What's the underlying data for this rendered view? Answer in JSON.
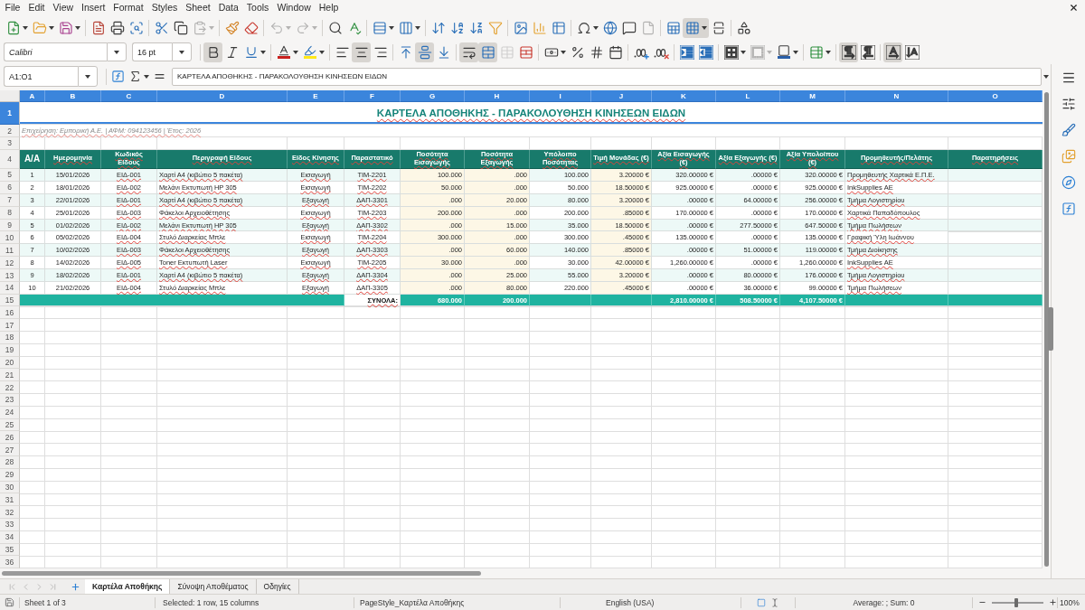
{
  "menu_bar": [
    "File",
    "Edit",
    "View",
    "Insert",
    "Format",
    "Styles",
    "Sheet",
    "Data",
    "Tools",
    "Window",
    "Help"
  ],
  "standard_toolbar": [
    {
      "on": false,
      "disabled": false
    },
    {
      "on": false,
      "disabled": false
    },
    {
      "on": false,
      "disabled": false
    },
    {
      "on": false,
      "disabled": false
    },
    {
      "on": false,
      "disabled": false
    },
    {
      "on": false,
      "disabled": false
    },
    {
      "on": false,
      "disabled": false
    },
    {
      "on": false,
      "disabled": false
    },
    {
      "on": false,
      "disabled": true
    },
    {
      "on": false,
      "disabled": false
    },
    {
      "on": false,
      "disabled": false
    },
    {
      "on": false,
      "disabled": true
    },
    {
      "on": false,
      "disabled": true
    },
    {
      "on": false,
      "disabled": false
    },
    {
      "on": false,
      "disabled": false
    },
    {
      "on": false,
      "disabled": false
    },
    {
      "on": false,
      "disabled": false
    },
    {
      "on": false,
      "disabled": false
    },
    {
      "on": false,
      "disabled": false
    },
    {
      "on": false,
      "disabled": false
    },
    {
      "on": false,
      "disabled": false
    },
    {
      "on": false,
      "disabled": false
    },
    {
      "on": false,
      "disabled": false
    },
    {
      "on": false,
      "disabled": false
    },
    {
      "on": false,
      "disabled": false
    },
    {
      "on": false,
      "disabled": false
    },
    {
      "on": false,
      "disabled": false
    },
    {
      "on": false,
      "disabled": true
    },
    {
      "on": false,
      "disabled": false
    },
    {
      "on": true,
      "disabled": false
    },
    {
      "on": false,
      "disabled": false
    },
    {
      "on": false,
      "disabled": false
    }
  ],
  "formatting_toolbar": {
    "font_name": "Calibri",
    "font_size": "16 pt",
    "buttons": [
      {
        "on": true,
        "disabled": false
      },
      {
        "on": false,
        "disabled": false
      },
      {
        "on": false,
        "disabled": false
      },
      {
        "on": false,
        "disabled": false
      },
      {
        "on": false,
        "disabled": false
      },
      {
        "on": false,
        "disabled": false
      },
      {
        "on": true,
        "disabled": false
      },
      {
        "on": false,
        "disabled": false
      },
      {
        "on": false,
        "disabled": false
      },
      {
        "on": true,
        "disabled": false
      },
      {
        "on": false,
        "disabled": false
      },
      {
        "on": true,
        "disabled": false
      },
      {
        "on": true,
        "disabled": false
      },
      {
        "on": false,
        "disabled": true
      },
      {
        "on": false,
        "disabled": false
      },
      {
        "on": false,
        "disabled": false
      },
      {
        "on": false,
        "disabled": false
      },
      {
        "on": false,
        "disabled": false
      },
      {
        "on": false,
        "disabled": false
      },
      {
        "on": false,
        "disabled": false
      },
      {
        "on": false,
        "disabled": false
      },
      {
        "on": false,
        "disabled": false
      },
      {
        "on": false,
        "disabled": false
      },
      {
        "on": false,
        "disabled": false
      },
      {
        "on": false,
        "disabled": true
      },
      {
        "on": false,
        "disabled": false
      },
      {
        "on": false,
        "disabled": false
      },
      {
        "on": true,
        "disabled": false
      },
      {
        "on": false,
        "disabled": false
      },
      {
        "on": true,
        "disabled": false
      },
      {
        "on": false,
        "disabled": false
      }
    ]
  },
  "formula_bar": {
    "name_box": "A1:O1",
    "formula": "ΚΑΡΤΕΛΑ ΑΠΟΘΗΚΗΣ - ΠΑΡΑΚΟΛΟΥΘΗΣΗ ΚΙΝΗΣΕΩΝ ΕΙΔΩΝ"
  },
  "sheet": {
    "column_headers": [
      {
        "label": "A",
        "selected": true
      },
      {
        "label": "B",
        "selected": true
      },
      {
        "label": "C",
        "selected": true
      },
      {
        "label": "D",
        "selected": true
      },
      {
        "label": "E",
        "selected": true
      },
      {
        "label": "F",
        "selected": true
      },
      {
        "label": "G",
        "selected": true
      },
      {
        "label": "H",
        "selected": true
      },
      {
        "label": "I",
        "selected": true
      },
      {
        "label": "J",
        "selected": true
      },
      {
        "label": "K",
        "selected": true
      },
      {
        "label": "L",
        "selected": true
      },
      {
        "label": "M",
        "selected": true
      },
      {
        "label": "N",
        "selected": true
      },
      {
        "label": "O",
        "selected": true
      }
    ],
    "row_headers": [
      {
        "label": "1",
        "selected": true
      },
      {
        "label": "2",
        "selected": false
      },
      {
        "label": "3",
        "selected": false
      },
      {
        "label": "4",
        "selected": false
      },
      {
        "label": "5",
        "selected": false
      },
      {
        "label": "6",
        "selected": false
      },
      {
        "label": "7",
        "selected": false
      },
      {
        "label": "8",
        "selected": false
      },
      {
        "label": "9",
        "selected": false
      },
      {
        "label": "10",
        "selected": false
      },
      {
        "label": "11",
        "selected": false
      },
      {
        "label": "12",
        "selected": false
      },
      {
        "label": "13",
        "selected": false
      },
      {
        "label": "14",
        "selected": false
      },
      {
        "label": "15",
        "selected": false
      },
      {
        "label": "16",
        "selected": false
      },
      {
        "label": "17",
        "selected": false
      },
      {
        "label": "18",
        "selected": false
      },
      {
        "label": "19",
        "selected": false
      },
      {
        "label": "20",
        "selected": false
      },
      {
        "label": "21",
        "selected": false
      },
      {
        "label": "22",
        "selected": false
      },
      {
        "label": "23",
        "selected": false
      },
      {
        "label": "24",
        "selected": false
      },
      {
        "label": "25",
        "selected": false
      },
      {
        "label": "26",
        "selected": false
      },
      {
        "label": "27",
        "selected": false
      },
      {
        "label": "28",
        "selected": false
      },
      {
        "label": "29",
        "selected": false
      },
      {
        "label": "30",
        "selected": false
      },
      {
        "label": "31",
        "selected": false
      },
      {
        "label": "32",
        "selected": false
      },
      {
        "label": "33",
        "selected": false
      },
      {
        "label": "34",
        "selected": false
      },
      {
        "label": "35",
        "selected": false
      },
      {
        "label": "36",
        "selected": false
      }
    ],
    "title": {
      "text": "ΚΑΡΤΕΛΑ ΑΠΟΘΗΚΗΣ - ΠΑΡΑΚΟΛΟΥΘΗΣΗ ΚΙΝΗΣΕΩΝ ΕΙΔΩΝ",
      "selected": true
    },
    "info_line": "Επιχείρηση: Εμπορική Α.Ε. | ΑΦΜ: 094123456 | Έτος: 2026",
    "table_headers": [
      "Α/Α",
      "Ημερομηνία",
      "Κωδικός Είδους",
      "Περιγραφή Είδους",
      "Είδος Κίνησης",
      "Παραστατικό",
      "Ποσότητα Εισαγωγής",
      "Ποσότητα Εξαγωγής",
      "Υπόλοιπο Ποσότητας",
      "Τιμή Μονάδας (€)",
      "Αξία Εισαγωγής (€)",
      "Αξία Εξαγωγής (€)",
      "Αξία Υπολοίπου (€)",
      "Προμηθευτής/Πελάτης",
      "Παρατηρήσεις"
    ],
    "rows": [
      {
        "cells": [
          "1",
          "15/01/2026",
          "ΕΙΔ-001",
          "Χαρτί Α4 (κιβώτιο 5 πακέτα)",
          "Εισαγωγή",
          "ΤΙΜ-2201",
          "100.000",
          ".000",
          "100.000",
          "3.20000 €",
          "320.00000 €",
          ".00000 €",
          "320.00000 €",
          "Προμηθευτής Χαρτικά Ε.Π.Ε."
        ]
      },
      {
        "cells": [
          "2",
          "18/01/2026",
          "ΕΙΔ-002",
          "Μελάνι Εκτυπωτή HP 305",
          "Εισαγωγή",
          "ΤΙΜ-2202",
          "50.000",
          ".000",
          "50.000",
          "18.50000 €",
          "925.00000 €",
          ".00000 €",
          "925.00000 €",
          "InkSupplies ΑΕ"
        ]
      },
      {
        "cells": [
          "3",
          "22/01/2026",
          "ΕΙΔ-001",
          "Χαρτί Α4 (κιβώτιο 5 πακέτα)",
          "Εξαγωγή",
          "ΔΑΠ-3301",
          ".000",
          "20.000",
          "80.000",
          "3.20000 €",
          ".00000 €",
          "64.00000 €",
          "256.00000 €",
          "Τμήμα Λογιστηρίου"
        ]
      },
      {
        "cells": [
          "4",
          "25/01/2026",
          "ΕΙΔ-003",
          "Φάκελοι Αρχειοθέτησης",
          "Εισαγωγή",
          "ΤΙΜ-2203",
          "200.000",
          ".000",
          "200.000",
          ".85000 €",
          "170.00000 €",
          ".00000 €",
          "170.00000 €",
          "Χαρτικά Παπαδόπουλος"
        ]
      },
      {
        "cells": [
          "5",
          "01/02/2026",
          "ΕΙΔ-002",
          "Μελάνι Εκτυπωτή HP 305",
          "Εξαγωγή",
          "ΔΑΠ-3302",
          ".000",
          "15.000",
          "35.000",
          "18.50000 €",
          ".00000 €",
          "277.50000 €",
          "647.50000 €",
          "Τμήμα Πωλήσεων"
        ]
      },
      {
        "cells": [
          "6",
          "05/02/2026",
          "ΕΙΔ-004",
          "Στυλό Διαρκείας Μπλε",
          "Εισαγωγή",
          "ΤΙΜ-2204",
          "300.000",
          ".000",
          "300.000",
          ".45000 €",
          "135.00000 €",
          ".00000 €",
          "135.00000 €",
          "Γραφική Ύλη Ιωάννου"
        ]
      },
      {
        "cells": [
          "7",
          "10/02/2026",
          "ΕΙΔ-003",
          "Φάκελοι Αρχειοθέτησης",
          "Εξαγωγή",
          "ΔΑΠ-3303",
          ".000",
          "60.000",
          "140.000",
          ".85000 €",
          ".00000 €",
          "51.00000 €",
          "119.00000 €",
          "Τμήμα Διοίκησης"
        ]
      },
      {
        "cells": [
          "8",
          "14/02/2026",
          "ΕΙΔ-005",
          "Toner Εκτυπωτή Laser",
          "Εισαγωγή",
          "ΤΙΜ-2205",
          "30.000",
          ".000",
          "30.000",
          "42.00000 €",
          "1,260.00000 €",
          ".00000 €",
          "1,260.00000 €",
          "InkSupplies ΑΕ"
        ]
      },
      {
        "cells": [
          "9",
          "18/02/2026",
          "ΕΙΔ-001",
          "Χαρτί Α4 (κιβώτιο 5 πακέτα)",
          "Εξαγωγή",
          "ΔΑΠ-3304",
          ".000",
          "25.000",
          "55.000",
          "3.20000 €",
          ".00000 €",
          "80.00000 €",
          "176.00000 €",
          "Τμήμα Λογιστηρίου"
        ]
      },
      {
        "cells": [
          "10",
          "21/02/2026",
          "ΕΙΔ-004",
          "Στυλό Διαρκείας Μπλε",
          "Εξαγωγή",
          "ΔΑΠ-3305",
          ".000",
          "80.000",
          "220.000",
          ".45000 €",
          ".00000 €",
          "36.00000 €",
          "99.00000 €",
          "Τμήμα Πωλήσεων"
        ]
      }
    ],
    "totals": {
      "label": "ΣΥΝΟΛΑ:",
      "qty_in": "680.000",
      "qty_out": "200.000",
      "value_in": "2,810.00000 €",
      "value_out": "508.50000 €",
      "balance_value": "4,107.50000 €"
    }
  },
  "sheet_tabs": {
    "nav": [
      {
        "disabled": true
      },
      {
        "disabled": true
      },
      {
        "disabled": true
      },
      {
        "disabled": true
      }
    ],
    "tabs": [
      {
        "label": "Καρτέλα Αποθήκης",
        "selected": true
      },
      {
        "label": "Σύνοψη Αποθέματος",
        "selected": false
      },
      {
        "label": "Οδηγίες",
        "selected": false
      }
    ]
  },
  "status_bar": {
    "sheet": "Sheet 1 of 3",
    "selection": "Selected: 1 row, 15 columns",
    "page_style": "PageStyle_Καρτέλα Αποθήκης",
    "language": "English (USA)",
    "summary": "Average: ; Sum: 0",
    "zoom": {
      "level": 0.47,
      "reading": "100%"
    }
  }
}
